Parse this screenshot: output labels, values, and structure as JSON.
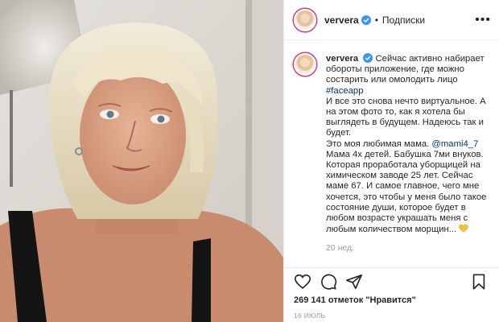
{
  "post": {
    "username": "ververa",
    "follow_state": "Подписки",
    "more_label": "•••",
    "caption": {
      "author": "ververa",
      "p1": "Сейчас активно набирает обороты приложение, где можно состарить или омолодить лицо",
      "hashtag": "#faceapp",
      "p2": "И все это снова нечто виртуальное. А на этом фото то, как я хотела бы выглядеть в будущем. Надеюсь так и будет.",
      "p3_before": "Это моя любимая мама. ",
      "mention": "@mami4_7",
      "p3_after": "Мама 4х детей. Бабушка 7ми внуков. Которая проработала уборщицей на химическом заводе 25 лет. Сейчас маме 67. И самое главное, чего мне хочется, это чтобы у меня было такое состояние души, которое будет в любом возрасте украшать меня с любым количеством морщин...",
      "emoji": "yellow-heart"
    },
    "time_ago": "20 нед.",
    "likes": "269 141 отметок \"Нравится\"",
    "date": "16 июль"
  },
  "icons": {
    "verified": "verified-badge-icon",
    "like": "heart-icon",
    "comment": "comment-icon",
    "share": "share-icon",
    "save": "bookmark-icon"
  },
  "colors": {
    "username": "#262626",
    "link": "#003569",
    "muted": "#999999",
    "verified": "#3897f0",
    "heart_emoji": "#f4c430"
  }
}
